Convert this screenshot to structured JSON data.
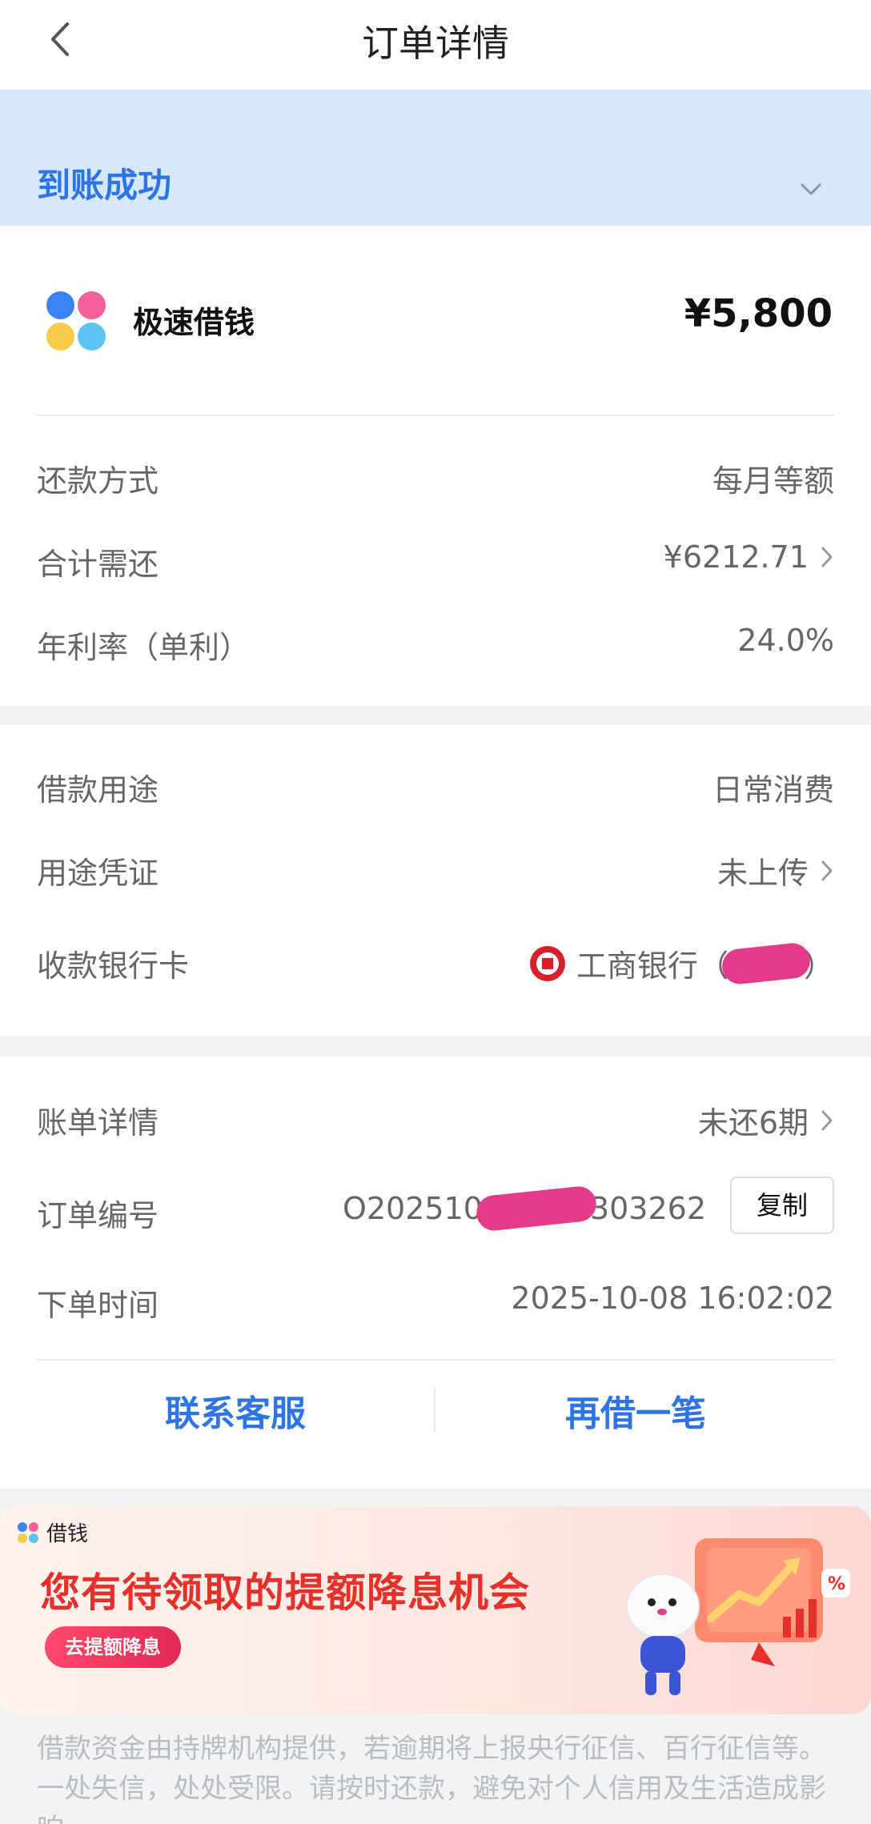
{
  "nav": {
    "title": "订单详情"
  },
  "status": {
    "label": "到账成功"
  },
  "product": {
    "name": "极速借钱",
    "amount": "¥5,800"
  },
  "loan_terms": [
    {
      "key": "还款方式",
      "value": "每月等额"
    },
    {
      "key": "合计需还",
      "value": "¥6212.71"
    },
    {
      "key": "年利率（单利）",
      "value": "24.0%"
    }
  ],
  "usage": [
    {
      "key": "借款用途",
      "value": "日常消费"
    },
    {
      "key": "用途凭证",
      "value": "未上传"
    }
  ],
  "bank_card": {
    "key": "收款银行卡",
    "bank_name": "工商银行",
    "open_paren": "（",
    "close_paren": "）"
  },
  "bill": {
    "key": "账单详情",
    "value": "未还6期"
  },
  "order": {
    "key": "订单编号",
    "number_prefix": "O202510",
    "number_suffix": "303262",
    "copy_label": "复制"
  },
  "order_time": {
    "key": "下单时间",
    "value": "2025-10-08 16:02:02"
  },
  "actions": {
    "contact": "联系客服",
    "borrow_again": "再借一笔"
  },
  "banner": {
    "brand": "借钱",
    "headline": "您有待领取的提额降息机会",
    "cta": "去提额降息"
  },
  "disclaimer": "借款资金由持牌机构提供，若逾期将上报央行征信、百行征信等。一处失信，处处受限。请按时还款，避免对个人信用及生活造成影响。",
  "colors": {
    "accent": "#2d74e6",
    "status_bg": "#d6e8fb",
    "banner_red": "#e8302b",
    "redaction": "#e53a87"
  }
}
